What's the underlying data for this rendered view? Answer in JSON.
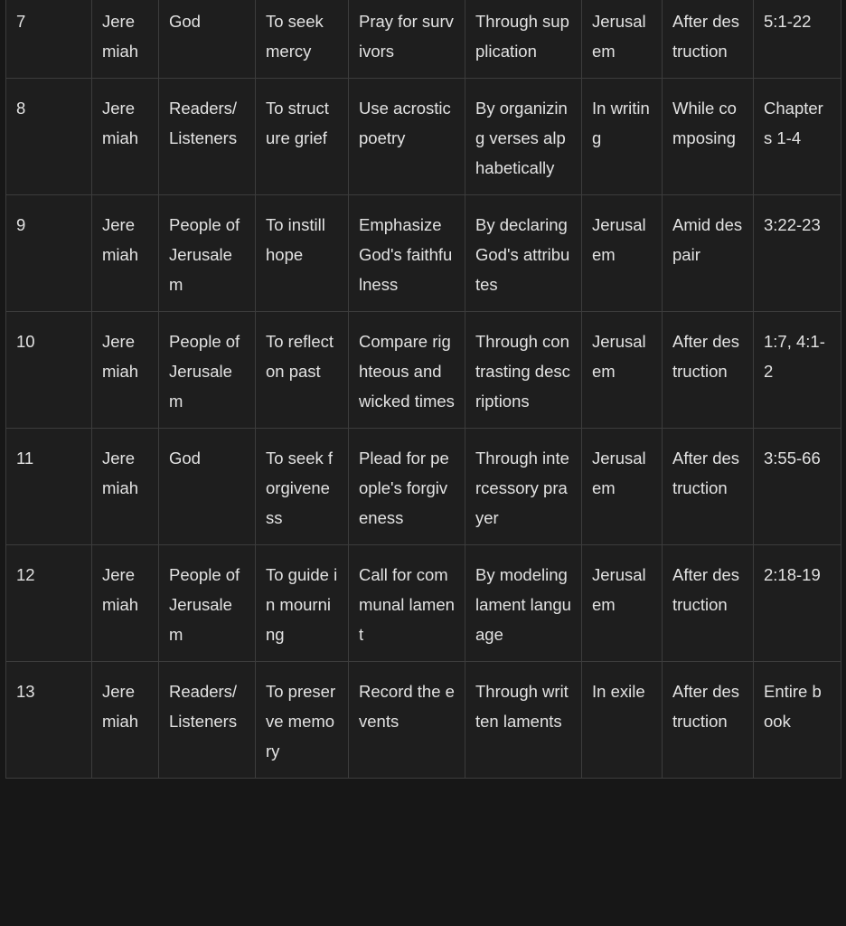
{
  "rows": [
    {
      "num": "7",
      "speaker": "Jeremiah",
      "audience": "God",
      "purpose": "To seek mercy",
      "action": "Pray for survivors",
      "method": "Through supplication",
      "place": "Jerusalem",
      "time": "After destruction",
      "reference": "5:1-22"
    },
    {
      "num": "8",
      "speaker": "Jeremiah",
      "audience": "Readers/ Listeners",
      "purpose": "To structure grief",
      "action": "Use acrostic poetry",
      "method": "By organizing verses alphabetically",
      "place": "In writing",
      "time": "While composing",
      "reference": "Chapters 1-4"
    },
    {
      "num": "9",
      "speaker": "Jeremiah",
      "audience": "People of Jerusalem",
      "purpose": "To instill hope",
      "action": "Emphasize God's faithfulness",
      "method": "By declaring God's attributes",
      "place": "Jerusalem",
      "time": "Amid despair",
      "reference": "3:22-23"
    },
    {
      "num": "10",
      "speaker": "Jeremiah",
      "audience": "People of Jerusalem",
      "purpose": "To reflect on past",
      "action": "Compare righteous and wicked times",
      "method": "Through contrasting descriptions",
      "place": "Jerusalem",
      "time": "After destruction",
      "reference": "1:7, 4:1-2"
    },
    {
      "num": "11",
      "speaker": "Jeremiah",
      "audience": "God",
      "purpose": "To seek forgiveness",
      "action": "Plead for people's forgiveness",
      "method": "Through intercessory prayer",
      "place": "Jerusalem",
      "time": "After destruction",
      "reference": "3:55-66"
    },
    {
      "num": "12",
      "speaker": "Jeremiah",
      "audience": "People of Jerusalem",
      "purpose": "To guide in mourning",
      "action": "Call for communal lament",
      "method": "By modeling lament language",
      "place": "Jerusalem",
      "time": "After destruction",
      "reference": "2:18-19"
    },
    {
      "num": "13",
      "speaker": "Jeremiah",
      "audience": "Readers/ Listeners",
      "purpose": "To preserve memory",
      "action": "Record the events",
      "method": "Through written laments",
      "place": "In exile",
      "time": "After destruction",
      "reference": "Entire book"
    }
  ]
}
